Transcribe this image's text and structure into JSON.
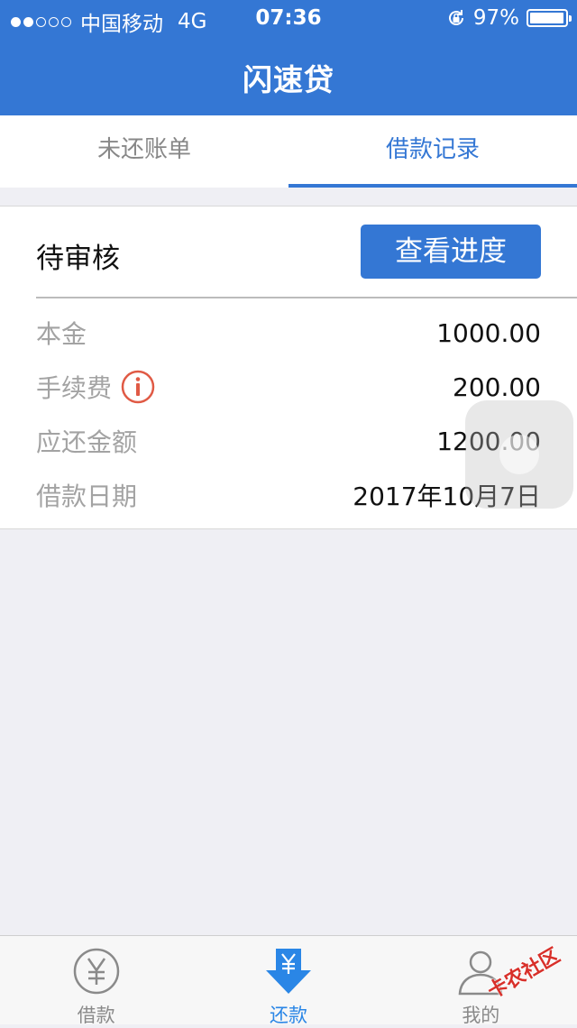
{
  "status_bar": {
    "carrier": "中国移动",
    "network": "4G",
    "time": "07:36",
    "battery": "97%",
    "signal_filled": 2,
    "signal_total": 5,
    "battery_level": 0.97
  },
  "nav": {
    "title": "闪速贷"
  },
  "tabs": [
    {
      "label": "未还账单",
      "active": false
    },
    {
      "label": "借款记录",
      "active": true
    }
  ],
  "record": {
    "status": "待审核",
    "progress_button": "查看进度",
    "rows": [
      {
        "label": "本金",
        "value": "1000.00"
      },
      {
        "label": "手续费",
        "value": "200.00",
        "icon": "info-icon"
      },
      {
        "label": "应还金额",
        "value": "1200.00"
      },
      {
        "label": "借款日期",
        "value": "2017年10月7日"
      }
    ]
  },
  "tabbar": [
    {
      "label": "借款",
      "icon": "yuan-circle-icon",
      "active": false
    },
    {
      "label": "还款",
      "icon": "yuan-download-icon",
      "active": true
    },
    {
      "label": "我的",
      "icon": "user-icon",
      "active": false
    }
  ],
  "watermark": "卡农社区",
  "colors": {
    "brand": "#3477d4",
    "tab_active": "#2a86e6",
    "info_icon": "#e05a45",
    "background": "#efeff4"
  }
}
